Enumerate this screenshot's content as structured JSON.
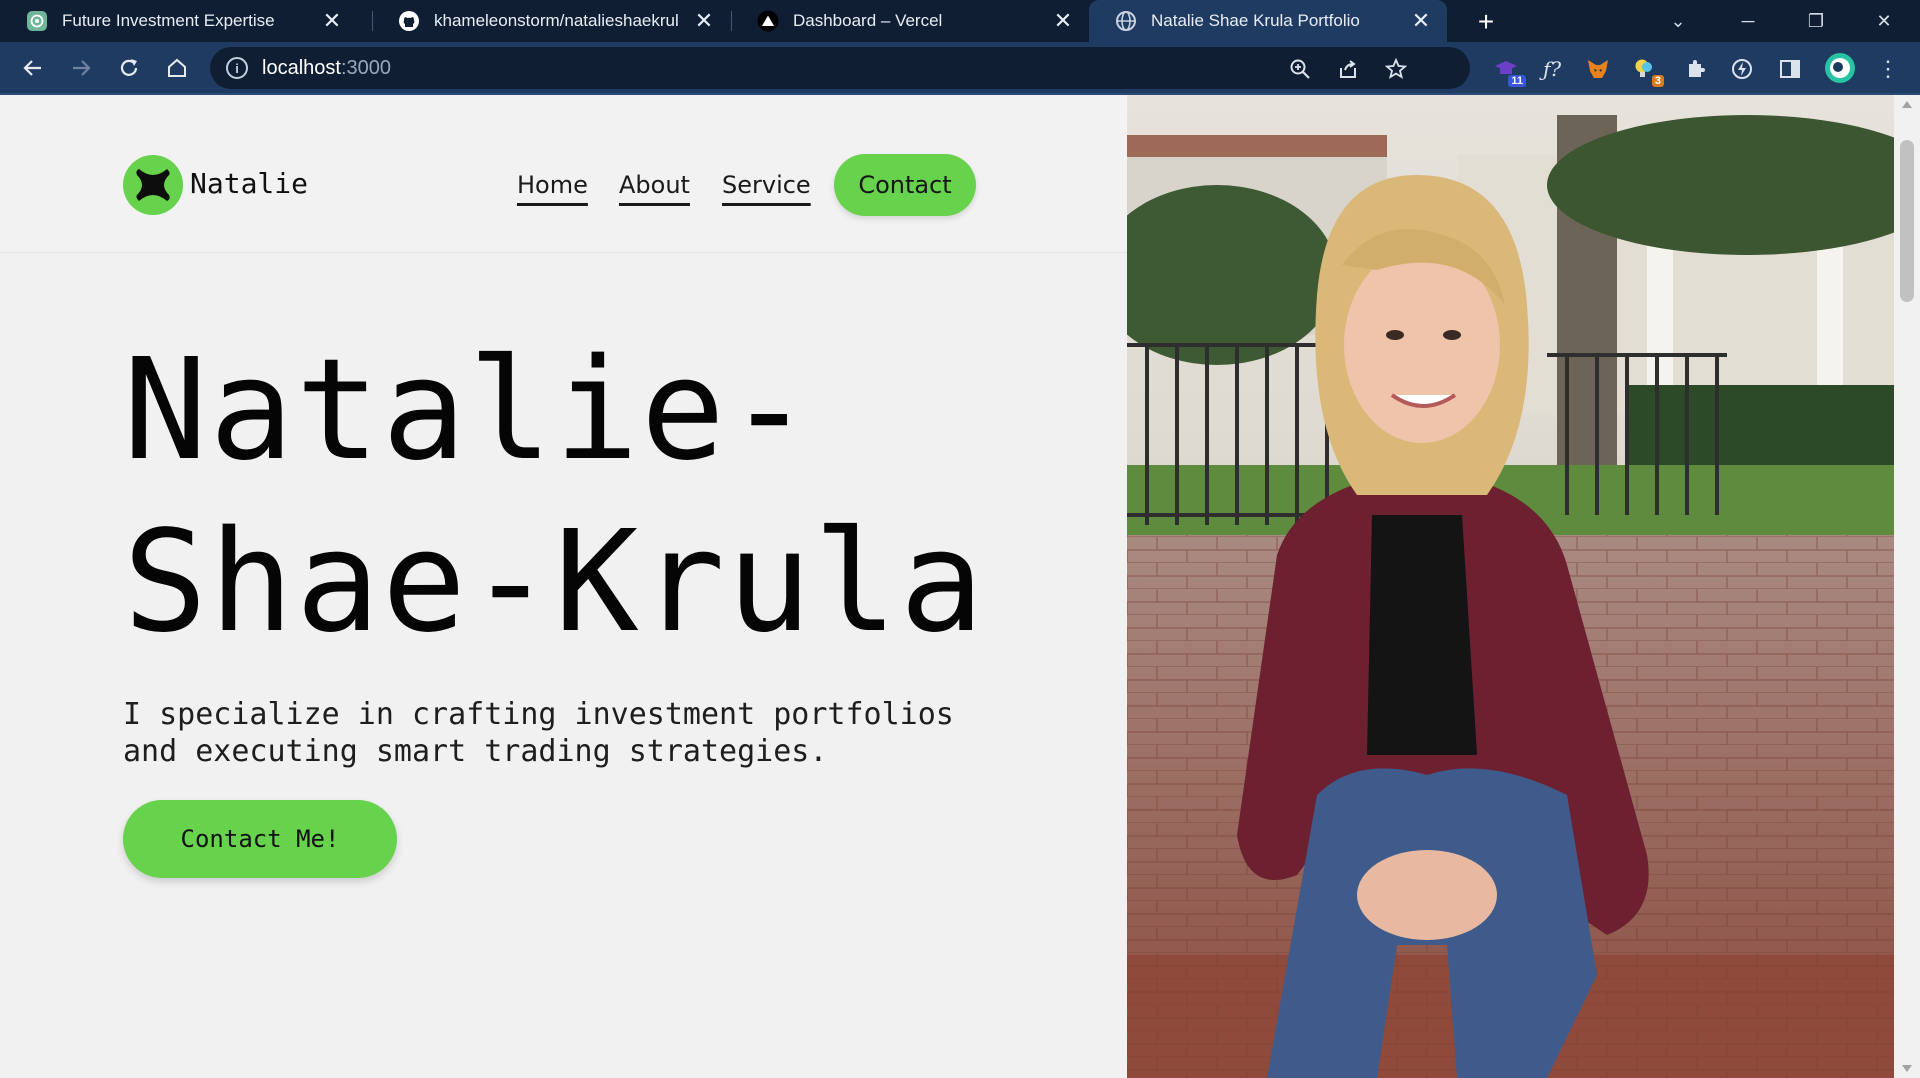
{
  "browser": {
    "tabs": [
      {
        "title": "Future Investment Expertise",
        "icon": "openai-icon"
      },
      {
        "title": "khameleonstorm/natalieshaekrul",
        "icon": "github-icon"
      },
      {
        "title": "Dashboard – Vercel",
        "icon": "vercel-icon"
      },
      {
        "title": "Natalie Shae Krula Portfolio",
        "icon": "globe-icon"
      }
    ],
    "url_host": "localhost",
    "url_port": ":3000",
    "extensions": [
      {
        "name": "graduation-cap-ext-icon",
        "badge": "11",
        "badge_color": "#3a55d8"
      },
      {
        "name": "formula-ext-icon"
      },
      {
        "name": "metamask-fox-icon"
      },
      {
        "name": "lightbulb-ext-icon",
        "badge": "3",
        "badge_color": "#d97a1c"
      },
      {
        "name": "puzzle-extensions-icon"
      },
      {
        "name": "bolt-ext-icon"
      },
      {
        "name": "sidepanel-icon"
      },
      {
        "name": "profile-avatar-icon"
      },
      {
        "name": "kebab-menu-icon"
      }
    ]
  },
  "site": {
    "logo_text": "Natalie",
    "nav": {
      "home": "Home",
      "about": "About",
      "service": "Service",
      "contact": "Contact"
    },
    "hero": {
      "title_line1": "Natalie-",
      "title_line2": "Shae-Krula",
      "subtitle_line1": "I specialize in crafting investment portfolios",
      "subtitle_line2": "and executing smart trading strategies.",
      "cta": "Contact Me!"
    },
    "photo_alt": "portrait-photo"
  },
  "colors": {
    "accent_green": "#67d24c",
    "chrome_dark": "#0f1e33",
    "chrome_active": "#203b61"
  }
}
